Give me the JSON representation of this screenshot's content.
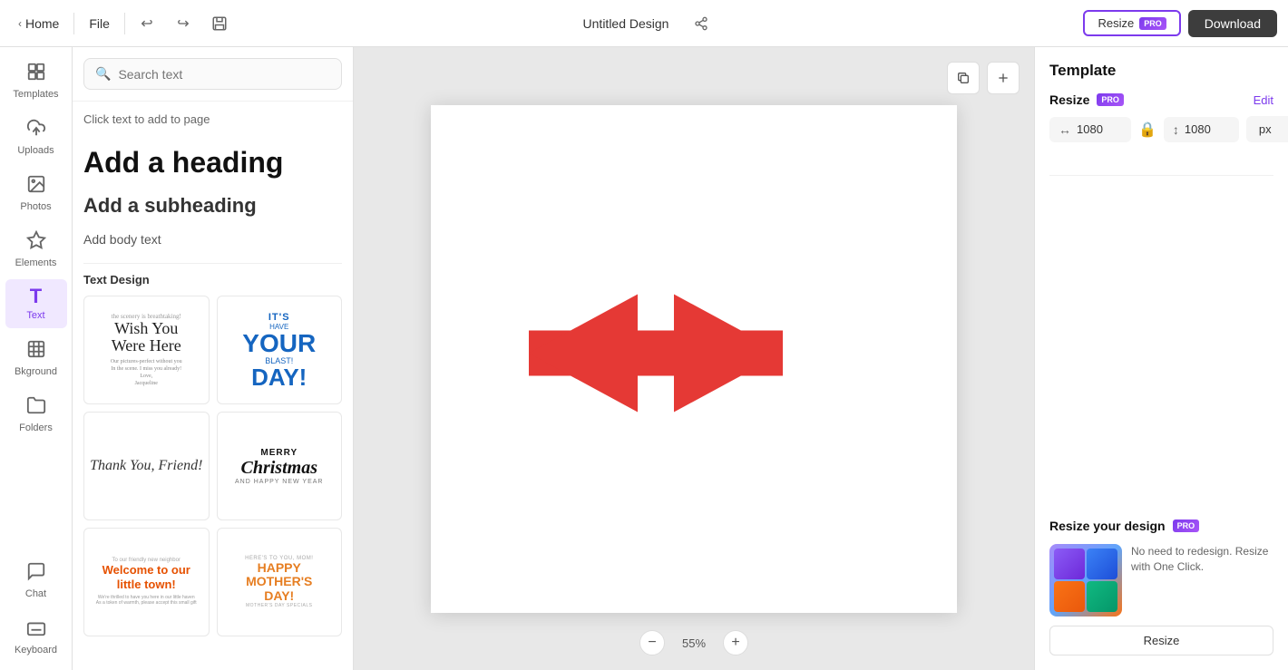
{
  "topbar": {
    "home_label": "Home",
    "file_label": "File",
    "title": "Untitled Design",
    "resize_label": "Resize",
    "pro_badge": "PRO",
    "download_label": "Download"
  },
  "nav": {
    "items": [
      {
        "id": "templates",
        "label": "Templates",
        "icon": "⊞"
      },
      {
        "id": "uploads",
        "label": "Uploads",
        "icon": "☁"
      },
      {
        "id": "photos",
        "label": "Photos",
        "icon": "🖼"
      },
      {
        "id": "elements",
        "label": "Elements",
        "icon": "✦"
      },
      {
        "id": "text",
        "label": "Text",
        "icon": "T"
      },
      {
        "id": "bkground",
        "label": "Bkground",
        "icon": "▤"
      },
      {
        "id": "folders",
        "label": "Folders",
        "icon": "📁"
      },
      {
        "id": "chat",
        "label": "Chat",
        "icon": "💬"
      },
      {
        "id": "keyboard",
        "label": "Keyboard",
        "icon": "⌨"
      }
    ]
  },
  "panel": {
    "search_placeholder": "Search text",
    "click_instruction": "Click text to add to page",
    "add_heading": "Add a heading",
    "add_subheading": "Add a subheading",
    "add_body": "Add body text",
    "text_design_label": "Text Design",
    "designs": [
      {
        "id": "wish-you",
        "label": "Wish You Were Here"
      },
      {
        "id": "its-your-day",
        "label": "It's Your Day"
      },
      {
        "id": "thank-you",
        "label": "Thank You, Friend!"
      },
      {
        "id": "merry-christmas",
        "label": "Merry Christmas"
      },
      {
        "id": "welcome",
        "label": "Welcome to our little town!"
      },
      {
        "id": "mothers-day",
        "label": "Happy Mother's Day!"
      }
    ]
  },
  "canvas": {
    "zoom": "55%",
    "zoom_percent": 55
  },
  "right_panel": {
    "title": "Template",
    "resize_label": "Resize",
    "pro_badge": "PRO",
    "edit_label": "Edit",
    "width": "1080",
    "height": "1080",
    "unit": "px",
    "resize_design_label": "Resize your design",
    "resize_design_pro": "PRO",
    "resize_design_description": "No need to redesign. Resize with One Click.",
    "resize_design_btn": "Resize"
  }
}
